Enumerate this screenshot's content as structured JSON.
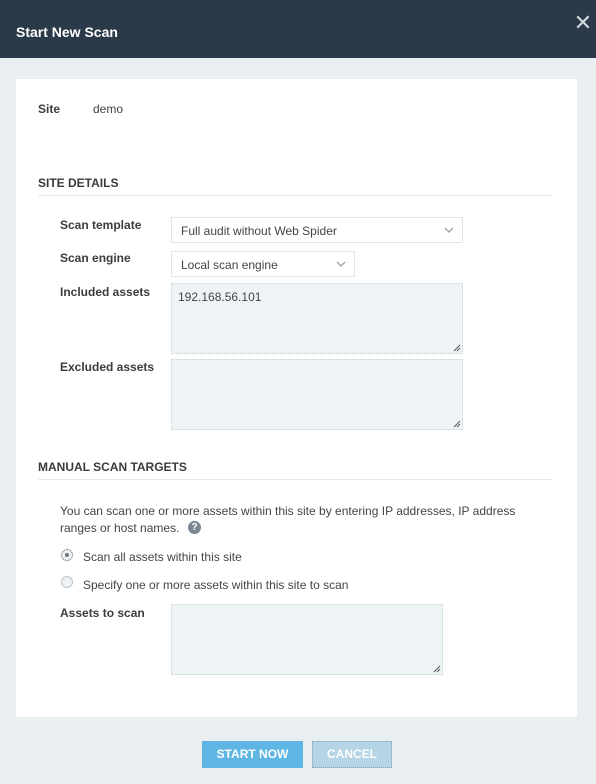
{
  "dialog": {
    "title": "Start New Scan",
    "close_icon": "close-icon"
  },
  "site": {
    "label": "Site",
    "value": "demo"
  },
  "site_details": {
    "heading": "SITE DETAILS",
    "scan_template": {
      "label": "Scan template",
      "value": "Full audit without Web Spider"
    },
    "scan_engine": {
      "label": "Scan engine",
      "value": "Local scan engine"
    },
    "included_assets": {
      "label": "Included assets",
      "value": "192.168.56.101"
    },
    "excluded_assets": {
      "label": "Excluded assets",
      "value": ""
    }
  },
  "manual_targets": {
    "heading": "MANUAL SCAN TARGETS",
    "description_line1": "You can scan one or more assets within this site by entering IP addresses, IP address",
    "description_line2": "ranges or host names.",
    "help_icon": "help-icon",
    "options": [
      {
        "label": "Scan all assets within this site",
        "checked": true
      },
      {
        "label": "Specify one or more assets within this site to scan",
        "checked": false
      }
    ],
    "assets_to_scan": {
      "label": "Assets to scan",
      "value": ""
    }
  },
  "footer": {
    "start_label": "START NOW",
    "cancel_label": "CANCEL"
  },
  "colors": {
    "titlebar": "#2b3a48",
    "primary_button": "#5fb6e4",
    "field_background": "#eef3f5"
  }
}
